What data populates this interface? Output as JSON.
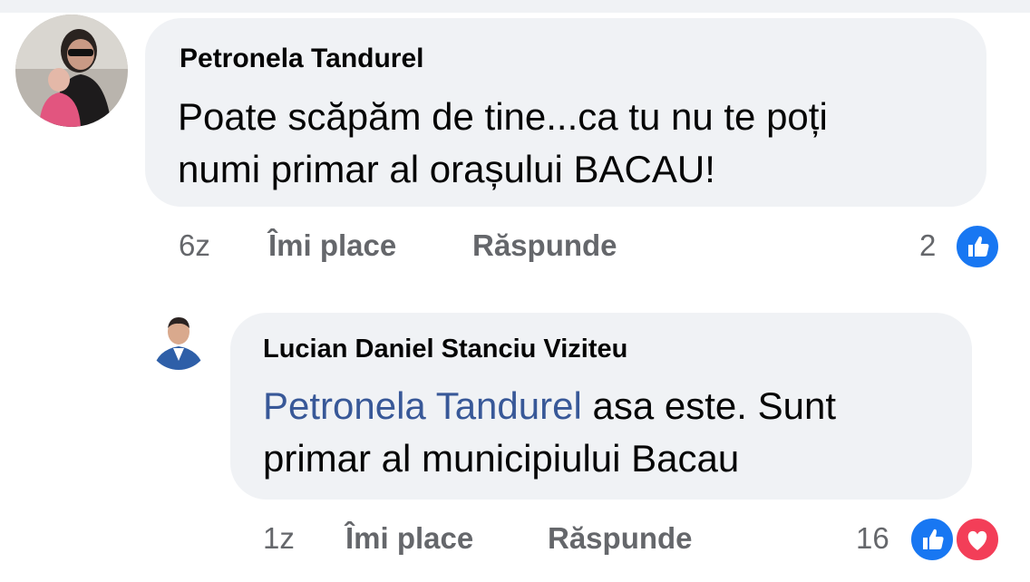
{
  "comments": [
    {
      "author": "Petronela Tandurel",
      "text_line1": "Poate scăpăm de tine...ca tu nu te poți",
      "text_line2": "numi primar al orașului BACAU!",
      "time": "6z",
      "like_label": "Îmi place",
      "reply_label": "Răspunde",
      "reaction_count": "2",
      "reactions": [
        "like-icon"
      ]
    },
    {
      "author": "Lucian Daniel Stanciu Viziteu",
      "mention": "Petronela Tandurel",
      "text_line1_rest": " asa este. Sunt",
      "text_line2": "primar al municipiului Bacau",
      "time": "1z",
      "like_label": "Îmi place",
      "reply_label": "Răspunde",
      "reaction_count": "16",
      "reactions": [
        "like-icon",
        "love-icon"
      ]
    }
  ],
  "colors": {
    "bubble": "#f0f2f5",
    "mention": "#385898",
    "meta": "#65676b",
    "like": "#1877f2",
    "love": "#f33e58"
  }
}
